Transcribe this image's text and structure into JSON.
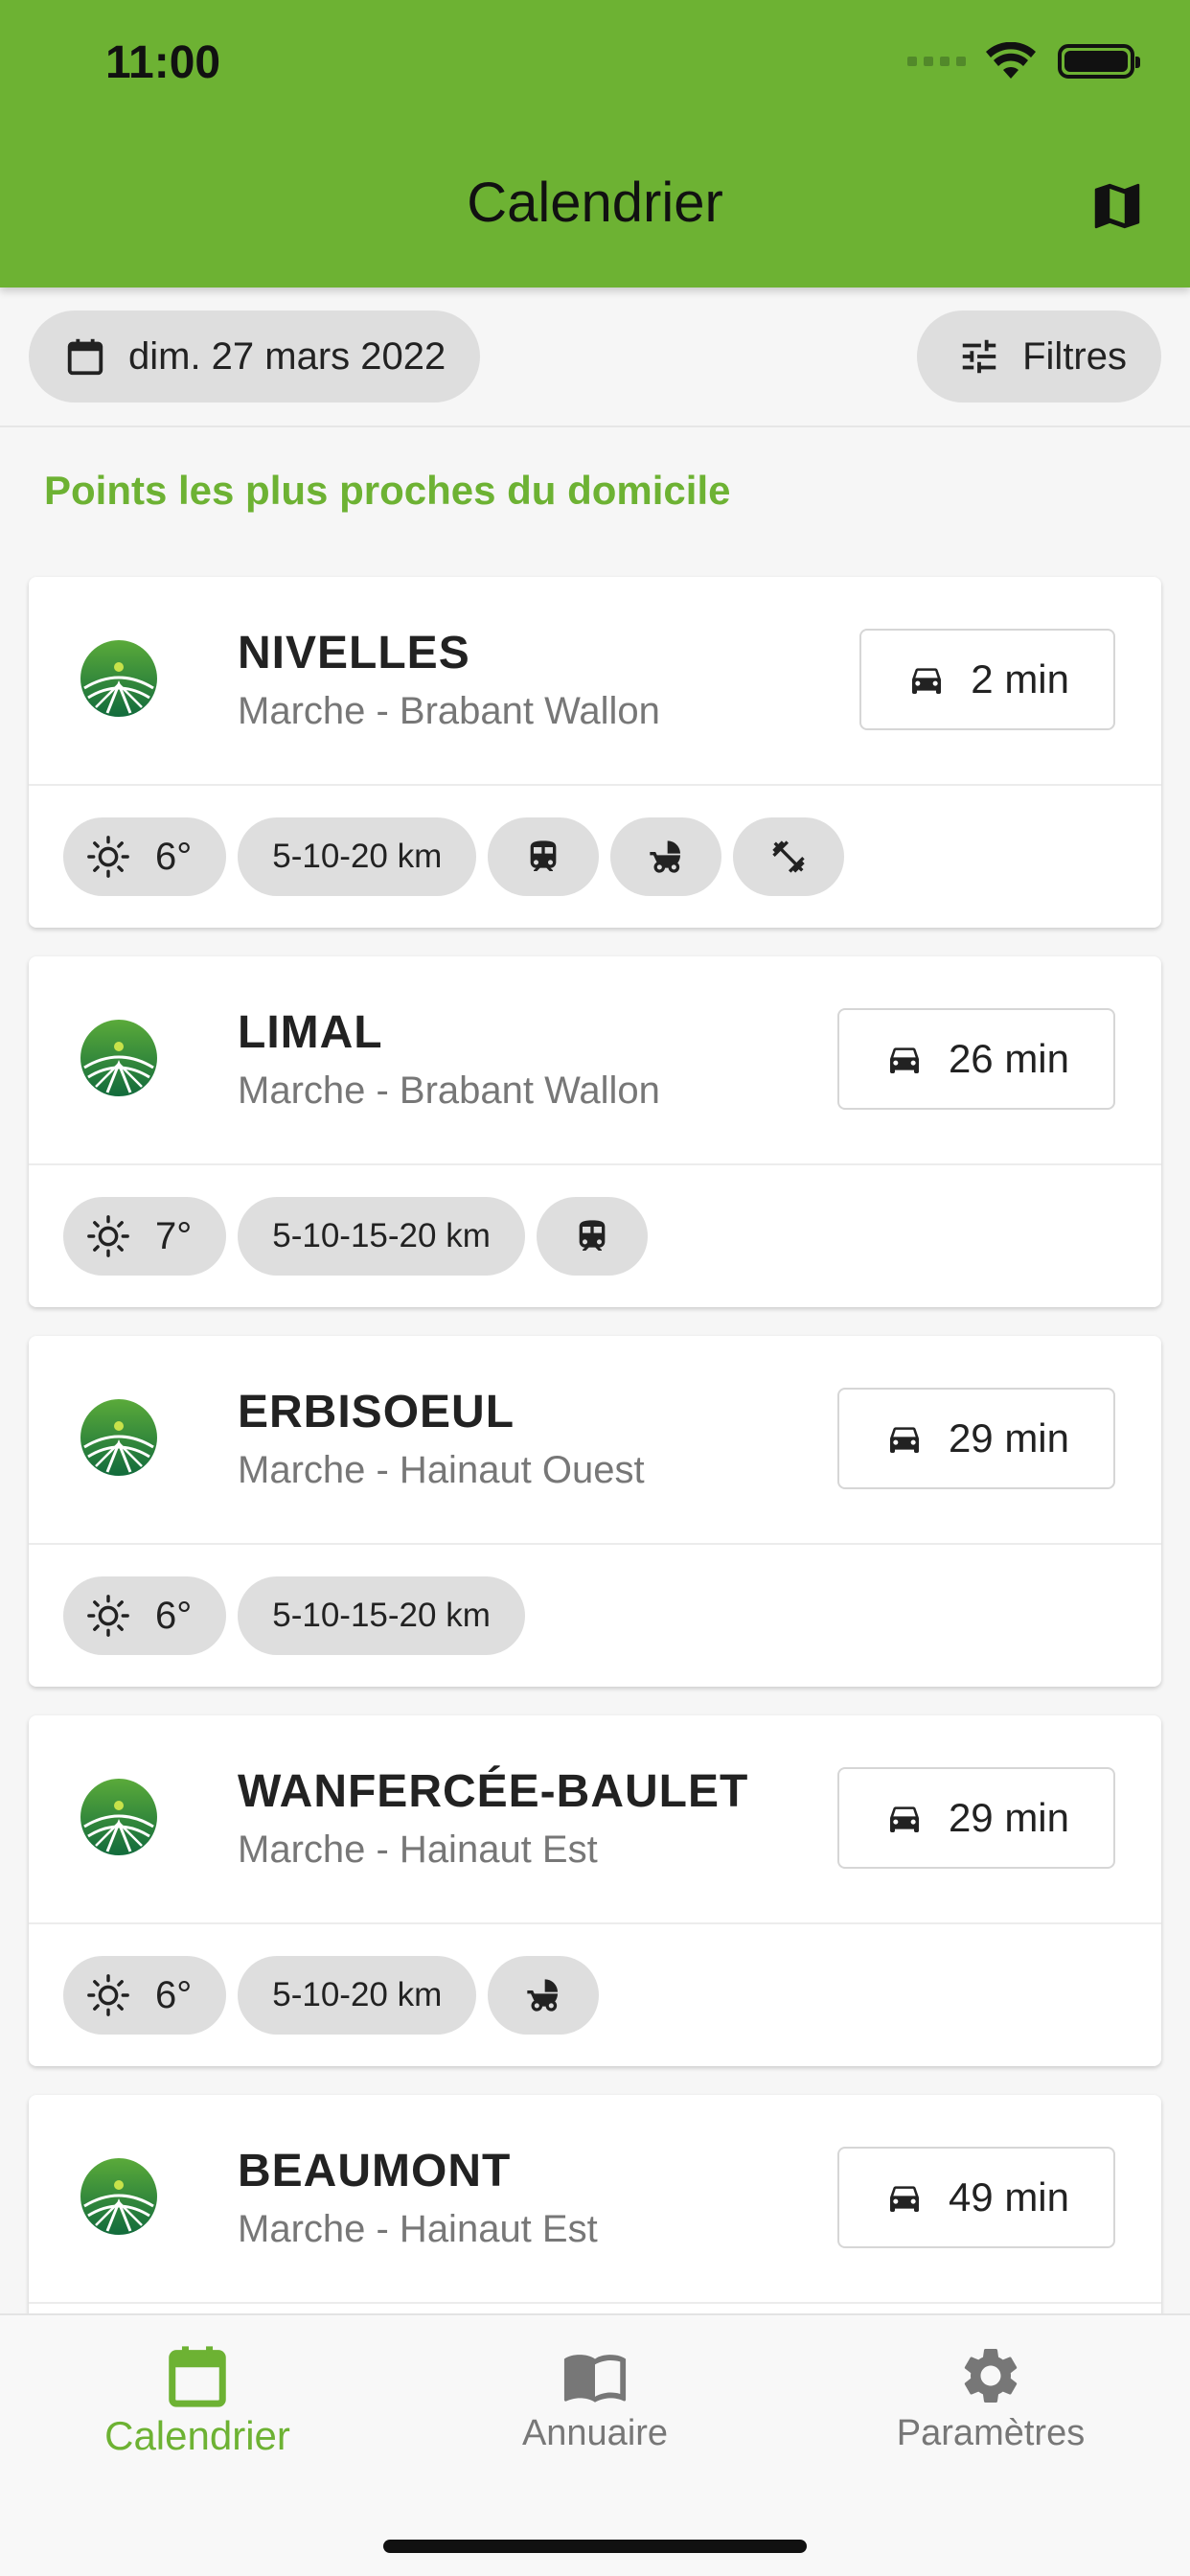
{
  "status_bar": {
    "time": "11:00"
  },
  "header": {
    "title": "Calendrier"
  },
  "toolbar": {
    "date_label": "dim. 27 mars 2022",
    "filters_label": "Filtres"
  },
  "section": {
    "title": "Points les plus proches du domicile"
  },
  "colors": {
    "brand_green": "#6db233",
    "chip_gray": "#dedede"
  },
  "cards": [
    {
      "name": "NIVELLES",
      "subtitle": "Marche - Brabant Wallon",
      "drive": "2 min",
      "temp": "6°",
      "distances": "5-10-20 km",
      "features": [
        "train-icon",
        "stroller-icon",
        "fitness-icon"
      ]
    },
    {
      "name": "LIMAL",
      "subtitle": "Marche - Brabant Wallon",
      "drive": "26 min",
      "temp": "7°",
      "distances": "5-10-15-20 km",
      "features": [
        "train-icon"
      ]
    },
    {
      "name": "ERBISOEUL",
      "subtitle": "Marche - Hainaut Ouest",
      "drive": "29 min",
      "temp": "6°",
      "distances": "5-10-15-20 km",
      "features": []
    },
    {
      "name": "WANFERCÉE-BAULET",
      "subtitle": "Marche - Hainaut Est",
      "drive": "29 min",
      "temp": "6°",
      "distances": "5-10-20 km",
      "features": [
        "stroller-icon"
      ]
    },
    {
      "name": "BEAUMONT",
      "subtitle": "Marche - Hainaut Est",
      "drive": "49 min"
    }
  ],
  "nav": {
    "calendar": "Calendrier",
    "directory": "Annuaire",
    "settings": "Paramètres"
  }
}
